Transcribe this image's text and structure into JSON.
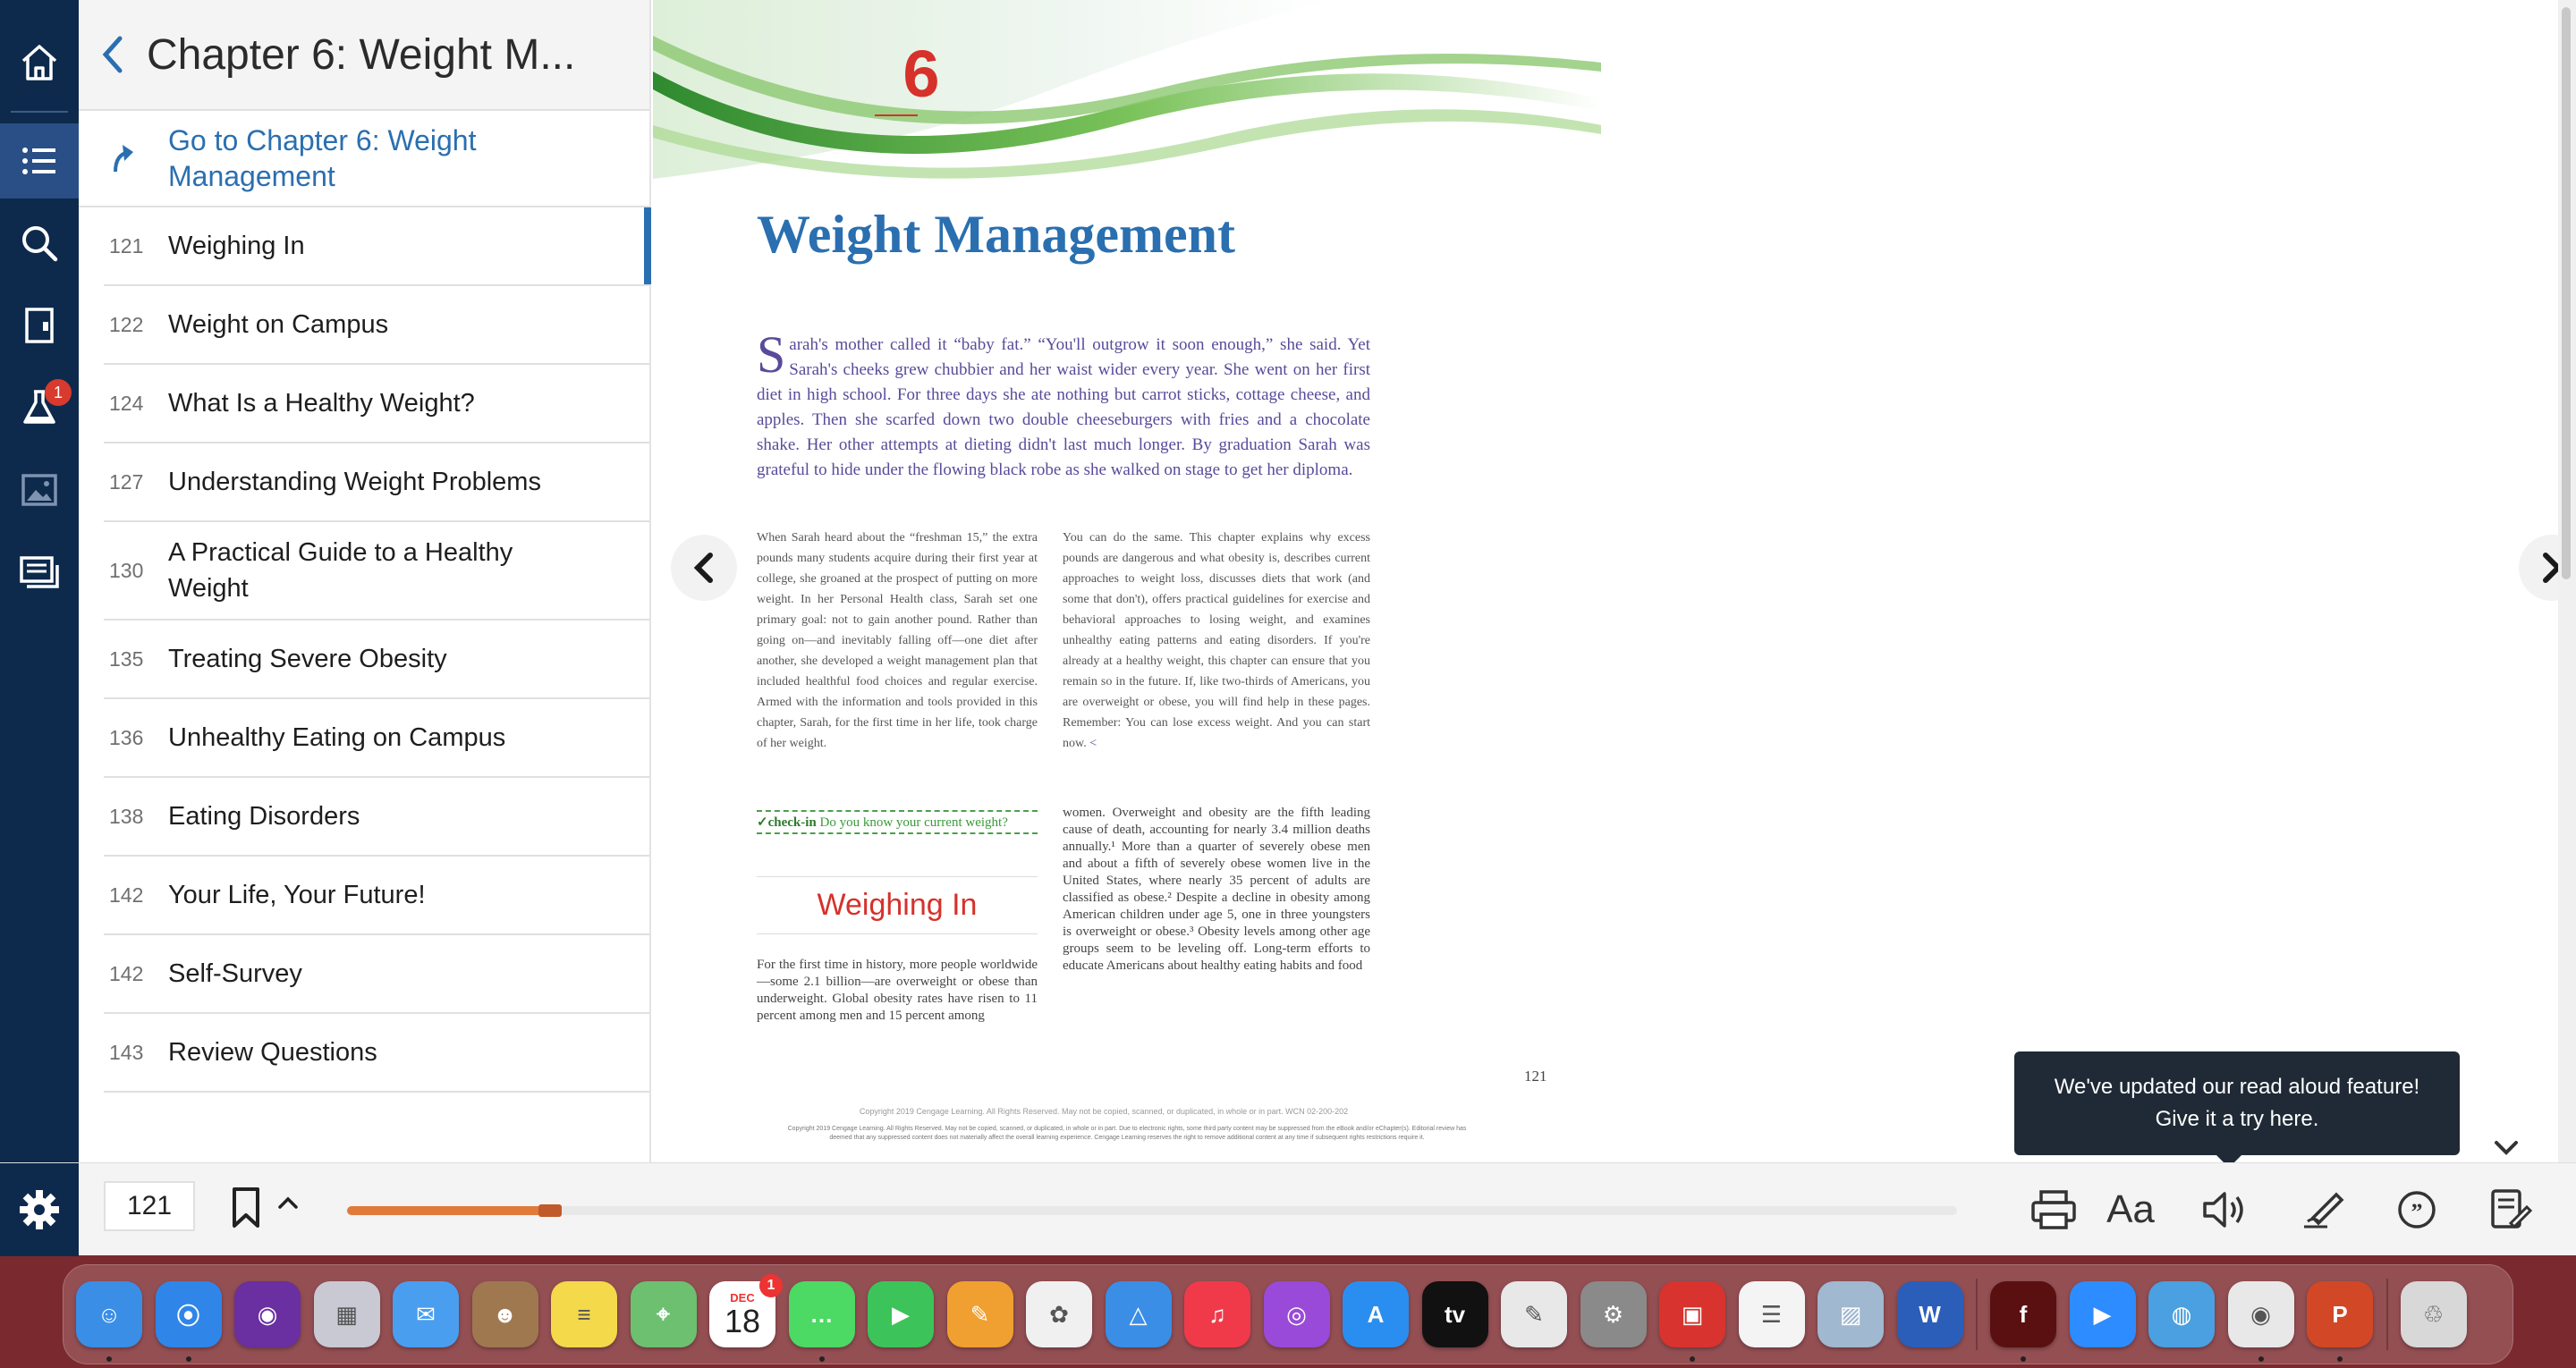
{
  "toc": {
    "header_title": "Chapter 6: Weight M...",
    "goto_label": "Go to Chapter 6: Weight Management",
    "items": [
      {
        "page": "121",
        "title": "Weighing In"
      },
      {
        "page": "122",
        "title": "Weight on Campus"
      },
      {
        "page": "124",
        "title": "What Is a Healthy Weight?"
      },
      {
        "page": "127",
        "title": "Understanding Weight Problems"
      },
      {
        "page": "130",
        "title": "A Practical Guide to a Healthy Weight"
      },
      {
        "page": "135",
        "title": "Treating Severe Obesity"
      },
      {
        "page": "136",
        "title": "Unhealthy Eating on Campus"
      },
      {
        "page": "138",
        "title": "Eating Disorders"
      },
      {
        "page": "142",
        "title": "Your Life, Your Future!"
      },
      {
        "page": "142",
        "title": "Self-Survey"
      },
      {
        "page": "143",
        "title": "Review Questions"
      }
    ]
  },
  "rail": {
    "lab_badge": "1",
    "items": [
      "home-icon",
      "toc-icon",
      "search-icon",
      "book-icon",
      "flask-icon",
      "image-icon",
      "notes-icon"
    ]
  },
  "page": {
    "chapter_number": "6",
    "title": "Weight Management",
    "intro_dropcap": "S",
    "intro_text": "arah's mother called it “baby fat.” “You'll outgrow it soon enough,” she said. Yet Sarah's cheeks grew chubbier and her waist wider every year. She went on her first diet in high school. For three days she ate nothing but carrot sticks, cottage cheese, and apples. Then she scarfed down two double cheeseburgers with fries and a chocolate shake. Her other attempts at dieting didn't last much longer. By graduation Sarah was grateful to hide under the flowing black robe as she walked on stage to get her diploma.",
    "col1_text": "When Sarah heard about the “freshman 15,” the extra pounds many students acquire during their first year at college, she groaned at the prospect of putting on more weight. In her Personal Health class, Sarah set one primary goal: not to gain another pound. Rather than going on—and inevitably falling off—one diet after another, she developed a weight management plan that included healthful food choices and regular exercise. Armed with the information and tools provided in this chapter, Sarah, for the first time in her life, took charge of her weight.",
    "col2_text": "You can do the same. This chapter explains why excess pounds are dangerous and what obesity is, describes current approaches to weight loss, discusses diets that work (and some that don't), offers practical guidelines for exercise and behavioral approaches to losing weight, and examines unhealthy eating patterns and eating disorders. If you're already at a healthy weight, this chapter can ensure that you remain so in the future. If, like two-thirds of Americans, you are overweight or obese, you will find help in these pages. Remember: You can lose excess weight. And you can start now.",
    "col2_end_mark": "<",
    "checkin_label": "✓check-in",
    "checkin_question": "Do you know your current weight?",
    "subheading": "Weighing In",
    "col4_text": "For the first time in history, more people worldwide—some 2.1 billion—are overweight or obese than underweight. Global obesity rates have risen to 11 percent among men and 15 percent among",
    "col3_text": "women. Overweight and obesity are the fifth leading cause of death, accounting for nearly 3.4 million deaths annually.¹ More than a quarter of severely obese men and about a fifth of severely obese women live in the United States, where nearly 35 percent of adults are classified as obese.² Despite a decline in obesity among American children under age 5, one in three youngsters is overweight or obese.³ Obesity levels among other age groups seem to be leveling off. Long-term efforts to educate Americans about healthy eating habits and food",
    "page_number": "121",
    "copyright_line1": "Copyright 2019 Cengage Learning. All Rights Reserved. May not be copied, scanned, or duplicated, in whole or in part. WCN 02-200-202",
    "copyright_line2": "Copyright 2019 Cengage Learning. All Rights Reserved. May not be copied, scanned, or duplicated, in whole or in part. Due to electronic rights, some third party content may be suppressed from the eBook and/or eChapter(s). Editorial review has deemed that any suppressed content does not materially affect the overall learning experience. Cengage Learning reserves the right to remove additional content at any time if subsequent rights restrictions require it."
  },
  "tooltip": {
    "line1": "We've updated our read aloud feature!",
    "line2": "Give it a try here."
  },
  "toolbar": {
    "current_page": "121",
    "progress": 0.13,
    "font_label": "Aa",
    "icons": [
      "print-icon",
      "font-size-icon",
      "read-aloud-icon",
      "highlight-icon",
      "citation-icon",
      "notes-icon"
    ]
  },
  "dock": {
    "calendar_month": "DEC",
    "calendar_day": "18",
    "calendar_badge": "1",
    "apps": [
      {
        "name": "Finder",
        "color": "#3a8ee6",
        "glyph": "☺"
      },
      {
        "name": "Safari",
        "color": "#2f86e8",
        "glyph": "⦿"
      },
      {
        "name": "Siri",
        "color": "#6a2fa0",
        "glyph": "◉"
      },
      {
        "name": "Launchpad",
        "color": "#c9c9d4",
        "glyph": "▦"
      },
      {
        "name": "Mail",
        "color": "#4a9ef0",
        "glyph": "✉"
      },
      {
        "name": "Contacts",
        "color": "#a07850",
        "glyph": "☻"
      },
      {
        "name": "Notes",
        "color": "#f4d94a",
        "glyph": "≡"
      },
      {
        "name": "Maps",
        "color": "#6cc070",
        "glyph": "⌖"
      },
      {
        "name": "Calendar",
        "color": "#ffffff",
        "glyph": ""
      },
      {
        "name": "Messages",
        "color": "#4cd964",
        "glyph": "…"
      },
      {
        "name": "FaceTime",
        "color": "#3cc45a",
        "glyph": "▶"
      },
      {
        "name": "Pages",
        "color": "#f0a030",
        "glyph": "✎"
      },
      {
        "name": "Photos",
        "color": "#f0f0f0",
        "glyph": "✿"
      },
      {
        "name": "Keynote",
        "color": "#3a8ee6",
        "glyph": "△"
      },
      {
        "name": "Music",
        "color": "#f03a4a",
        "glyph": "♫"
      },
      {
        "name": "Podcasts",
        "color": "#9a4ad8",
        "glyph": "◎"
      },
      {
        "name": "App Store",
        "color": "#2a8ef0",
        "glyph": "A"
      },
      {
        "name": "Apple TV",
        "color": "#111111",
        "glyph": "tv"
      },
      {
        "name": "TextEdit",
        "color": "#e8e8e8",
        "glyph": "✎"
      },
      {
        "name": "System Preferences",
        "color": "#8a8a8a",
        "glyph": "⚙"
      },
      {
        "name": "Photo Booth",
        "color": "#d8332e",
        "glyph": "▣"
      },
      {
        "name": "Reminders",
        "color": "#f4f4f4",
        "glyph": "☰"
      },
      {
        "name": "Preview",
        "color": "#a0b8d0",
        "glyph": "▨"
      },
      {
        "name": "Word",
        "color": "#2b5eb8",
        "glyph": "W"
      },
      {
        "name": "Flash",
        "color": "#5a1010",
        "glyph": "f"
      },
      {
        "name": "Zoom",
        "color": "#2d8cff",
        "glyph": "▶"
      },
      {
        "name": "Network",
        "color": "#4aa0e0",
        "glyph": "◍"
      },
      {
        "name": "Chrome",
        "color": "#e8e8e8",
        "glyph": "◉"
      },
      {
        "name": "PowerPoint",
        "color": "#d24726",
        "glyph": "P"
      },
      {
        "name": "Trash",
        "color": "#d8d8d8",
        "glyph": "♲"
      }
    ]
  }
}
